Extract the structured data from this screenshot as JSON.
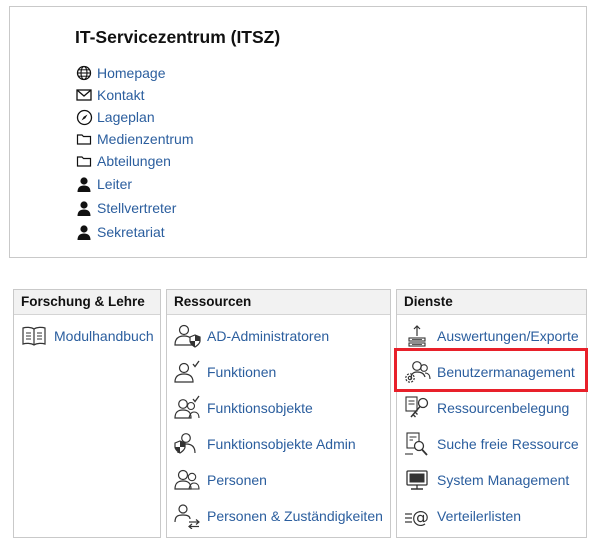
{
  "header": {
    "title": "IT-Servicezentrum (ITSZ)",
    "links": [
      {
        "label": "Homepage",
        "icon": "globe-icon"
      },
      {
        "label": "Kontakt",
        "icon": "envelope-icon"
      },
      {
        "label": "Lageplan",
        "icon": "compass-icon"
      },
      {
        "label": "Medienzentrum",
        "icon": "folder-icon"
      },
      {
        "label": "Abteilungen",
        "icon": "folder-icon"
      },
      {
        "label": "Leiter",
        "icon": "person-icon"
      },
      {
        "label": "Stellvertreter",
        "icon": "person-icon"
      },
      {
        "label": "Sekretariat",
        "icon": "person-icon"
      }
    ]
  },
  "columns": {
    "forschung": {
      "title": "Forschung & Lehre",
      "items": [
        {
          "label": "Modulhandbuch",
          "icon": "book-icon"
        }
      ]
    },
    "ressourcen": {
      "title": "Ressourcen",
      "items": [
        {
          "label": "AD-Administratoren",
          "icon": "users-admin-icon"
        },
        {
          "label": "Funktionen",
          "icon": "user-check-icon"
        },
        {
          "label": "Funktionsobjekte",
          "icon": "users-check-icon"
        },
        {
          "label": "Funktionsobjekte Admin",
          "icon": "users-shield-icon"
        },
        {
          "label": "Personen",
          "icon": "users-icon"
        },
        {
          "label": "Personen & Zuständigkeiten",
          "icon": "user-transfer-icon"
        }
      ]
    },
    "dienste": {
      "title": "Dienste",
      "items": [
        {
          "label": "Auswertungen/Exporte",
          "icon": "export-icon"
        },
        {
          "label": "Benutzermanagement",
          "icon": "users-gear-icon"
        },
        {
          "label": "Ressourcenbelegung",
          "icon": "key-icon"
        },
        {
          "label": "Suche freie Ressource",
          "icon": "resource-search-icon"
        },
        {
          "label": "System Management",
          "icon": "monitor-icon"
        },
        {
          "label": "Verteilerlisten",
          "icon": "mailing-list-icon"
        }
      ]
    }
  },
  "highlight_color": "#e8202a",
  "link_color": "#2b5e9e"
}
